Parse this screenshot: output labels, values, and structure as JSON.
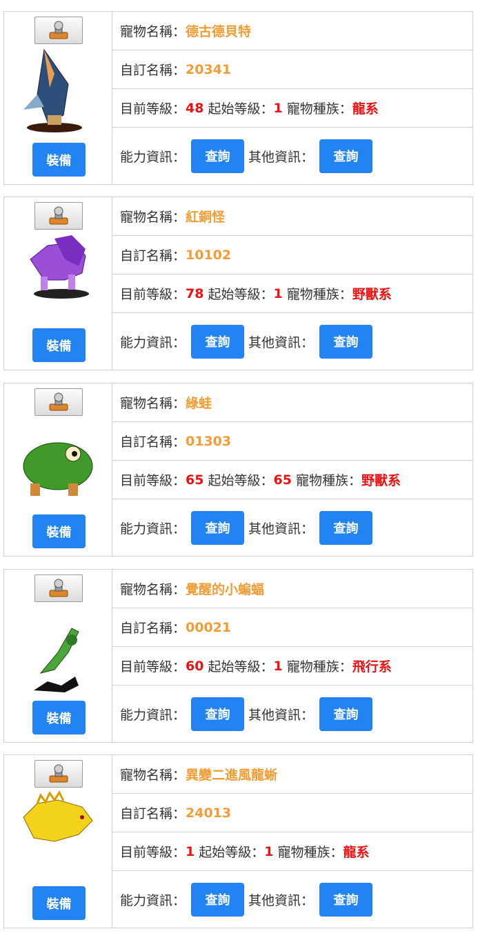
{
  "labels": {
    "name": "寵物名稱：",
    "custom": "自訂名稱：",
    "level": "目前等級：",
    "start": "起始等級：",
    "race": "寵物種族：",
    "ability": "能力資訊：",
    "other": "其他資訊：",
    "query": "查詢",
    "equip": "裝備"
  },
  "pets": [
    {
      "name": "德古德貝特",
      "custom": "20341",
      "level": "48",
      "start": "1",
      "race": "龍系",
      "art": "shark-bird-icon"
    },
    {
      "name": "紅銅怪",
      "custom": "10102",
      "level": "78",
      "start": "1",
      "race": "野獸系",
      "art": "purple-lion-icon"
    },
    {
      "name": "綠蛙",
      "custom": "01303",
      "level": "65",
      "start": "65",
      "race": "野獸系",
      "art": "green-frog-icon"
    },
    {
      "name": "覺醒的小蝙蝠",
      "custom": "00021",
      "level": "60",
      "start": "1",
      "race": "飛行系",
      "art": "bat-icon"
    },
    {
      "name": "異變二進風龍蜥",
      "custom": "24013",
      "level": "1",
      "start": "1",
      "race": "龍系",
      "art": "yellow-lizard-icon"
    }
  ],
  "colors": {
    "button": "#2283f2",
    "name": "#f39c34",
    "value": "#ee1111",
    "border": "#cfcfcf"
  }
}
